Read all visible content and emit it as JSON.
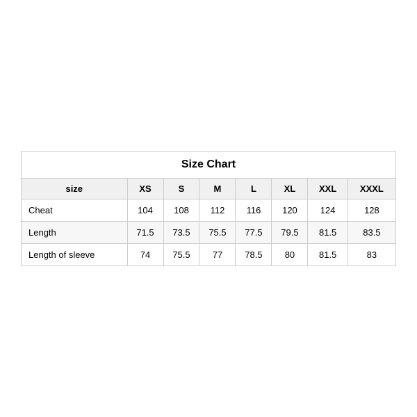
{
  "chart": {
    "title": "Size Chart",
    "headers": {
      "label": "size",
      "sizes": [
        "XS",
        "S",
        "M",
        "L",
        "XL",
        "XXL",
        "XXXL"
      ]
    },
    "rows": [
      {
        "label": "Cheat",
        "values": [
          "104",
          "108",
          "112",
          "116",
          "120",
          "124",
          "128"
        ]
      },
      {
        "label": "Length",
        "values": [
          "71.5",
          "73.5",
          "75.5",
          "77.5",
          "79.5",
          "81.5",
          "83.5"
        ]
      },
      {
        "label": "Length of sleeve",
        "values": [
          "74",
          "75.5",
          "77",
          "78.5",
          "80",
          "81.5",
          "83"
        ]
      }
    ]
  }
}
